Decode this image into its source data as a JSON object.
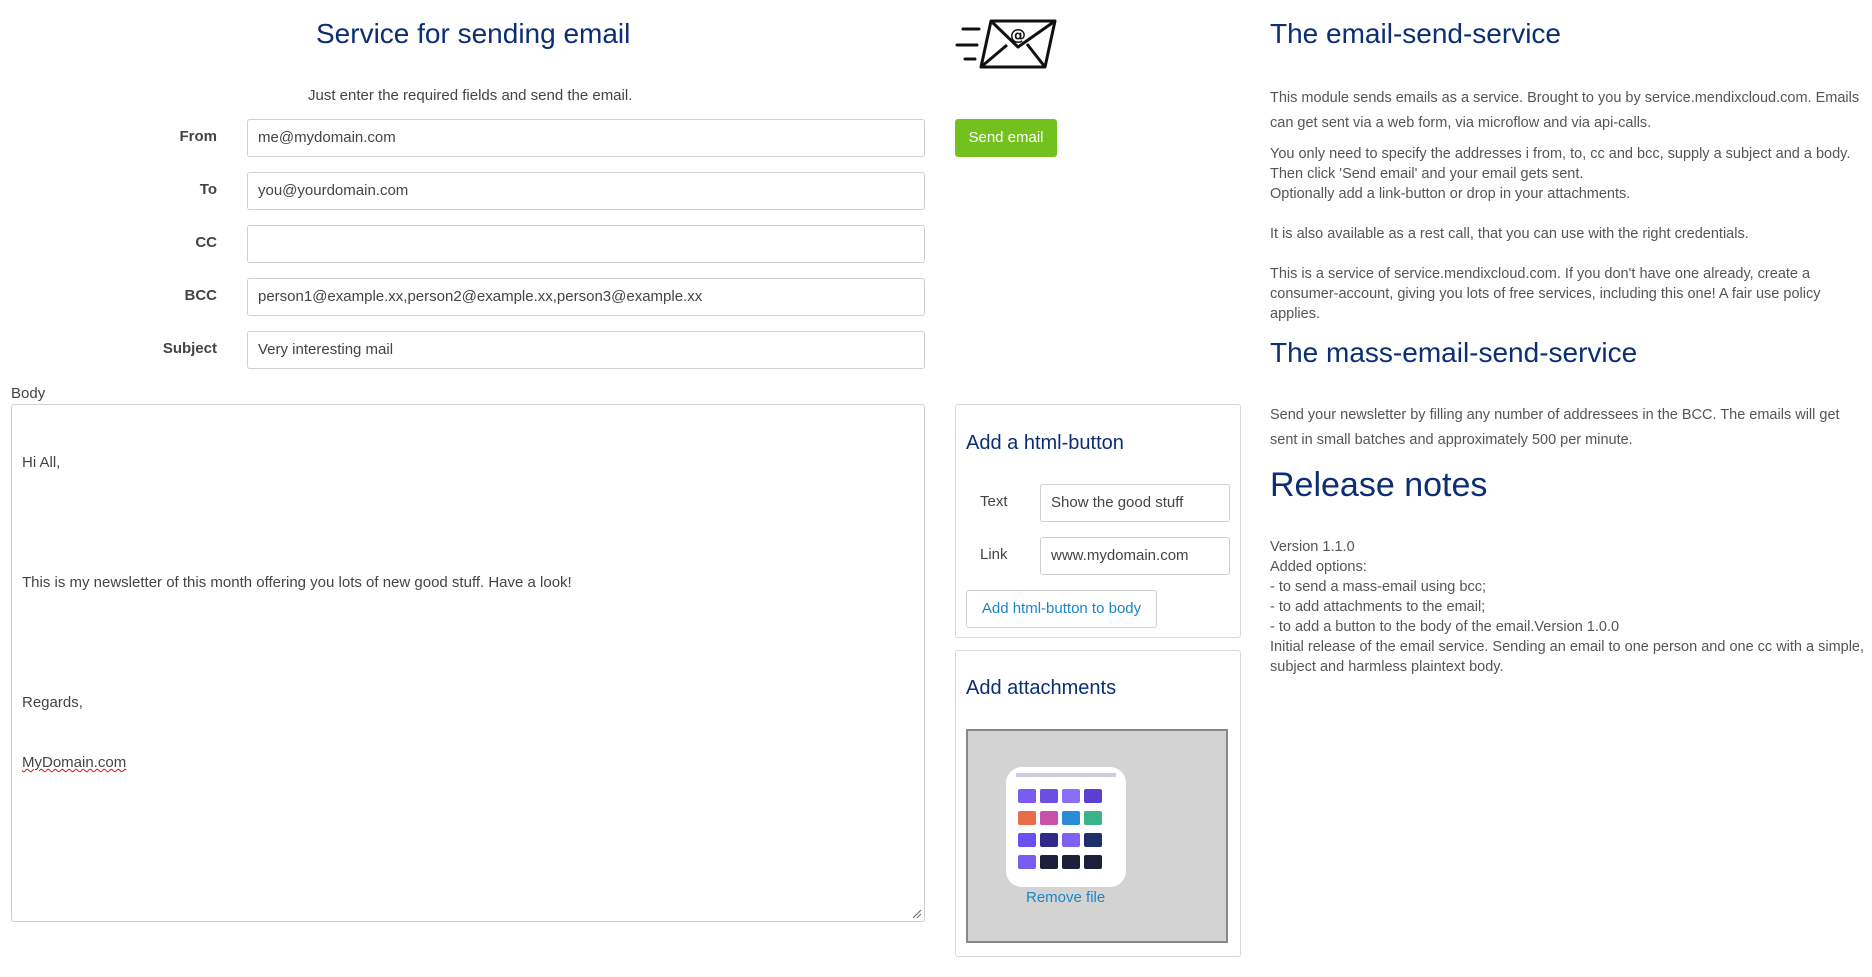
{
  "form": {
    "title": "Service for sending email",
    "subtitle": "Just enter the required fields and send the email.",
    "from_label": "From",
    "from_value": "me@mydomain.com",
    "to_label": "To",
    "to_value": "you@yourdomain.com",
    "cc_label": "CC",
    "cc_value": "",
    "bcc_label": "BCC",
    "bcc_value": "person1@example.xx,person2@example.xx,person3@example.xx",
    "subject_label": "Subject",
    "subject_value": "Very interesting mail",
    "body_label": "Body",
    "body_line1": "Hi All,",
    "body_line2": "This is my newsletter of this month offering you lots of new good stuff. Have a look!",
    "body_line3": "Regards,",
    "body_line4": "MyDomain.com"
  },
  "actions": {
    "send_label": "Send email"
  },
  "html_button_panel": {
    "title": "Add a html-button",
    "text_label": "Text",
    "text_value": "Show the good stuff",
    "link_label": "Link",
    "link_value": "www.mydomain.com",
    "add_button_label": "Add html-button to body"
  },
  "attachments_panel": {
    "title": "Add attachments",
    "remove_label": "Remove file"
  },
  "info": {
    "service_title": "The email-send-service",
    "service_p1": "This module sends emails as a service. Brought to you by service.mendixcloud.com. Emails can get sent via a web form, via microflow and via api-calls.",
    "service_p2_l1": "You only need to specify the addresses i from, to, cc and bcc, supply a subject and a body.",
    "service_p2_l2": "Then click 'Send email' and your email gets sent.",
    "service_p2_l3": "Optionally add a link-button or drop in your attachments.",
    "service_p3": "It is also available as a rest call, that you can use with the right credentials.",
    "service_p4": "This is a service of service.mendixcloud.com. If you don't have one already, create a consumer-account, giving you lots of free services, including this one! A fair use policy applies.",
    "mass_title": "The mass-email-send-service",
    "mass_p1": "Send your newsletter by filling any number of addressees in the BCC. The emails will get sent in small batches and approximately 500 per minute.",
    "release_title": "Release notes",
    "release_l1": "Version 1.1.0",
    "release_l2": "Added options:",
    "release_l3": "- to send a mass-email using bcc;",
    "release_l4": "- to add attachments to the email;",
    "release_l5": "- to add a button to the body of the email.Version 1.0.0",
    "release_l6": "Initial release of the email service. Sending an email to one person and one cc with a simple,",
    "release_l7": "subject and harmless plaintext body."
  },
  "icons": {
    "email_logo": "envelope-at-icon",
    "resize_grip": "resize-grip-icon",
    "attachment_thumbnail": "image-thumbnail"
  },
  "colors": {
    "title": "#0b2e74",
    "send_button": "#72c11c",
    "link": "#1a87c6",
    "dropzone": "#d3d3d3"
  }
}
